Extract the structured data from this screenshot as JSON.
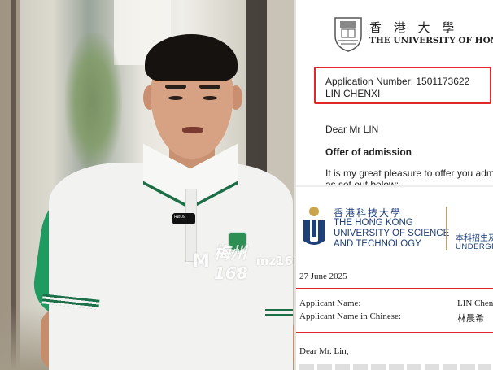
{
  "photo": {
    "mic_label": "RØDE"
  },
  "watermark": {
    "logo": "M",
    "text": "梅州168",
    "url": "mz168.com"
  },
  "hku_letter": {
    "name_zh": "香 港 大 學",
    "name_en": "THE UNIVERSITY OF HONG KONG",
    "application_number": "Application Number: 1501173622",
    "applicant_name": "LIN CHENXI",
    "salutation": "Dear Mr LIN",
    "heading": "Offer of admission",
    "body_line1": "It is my great pleasure to offer you admission",
    "body_line2": "as set out below:",
    "highlight_color": "#e2262a"
  },
  "hkust_letter": {
    "name_zh": "香港科技大學",
    "name_en_line1": "THE HONG KONG",
    "name_en_line2": "UNIVERSITY OF SCIENCE",
    "name_en_line3": "AND TECHNOLOGY",
    "office_zh": "本科招生及",
    "office_en": "UNDERGR",
    "date": "27 June 2025",
    "applicant_name_label": "Applicant Name:",
    "applicant_name_value": "LIN Chenx",
    "applicant_name_zh_label": "Applicant Name in Chinese:",
    "applicant_name_zh_value": "林晨希",
    "salutation": "Dear Mr. Lin,",
    "brand_color": "#1d3f7a",
    "highlight_color": "#e2262a"
  }
}
